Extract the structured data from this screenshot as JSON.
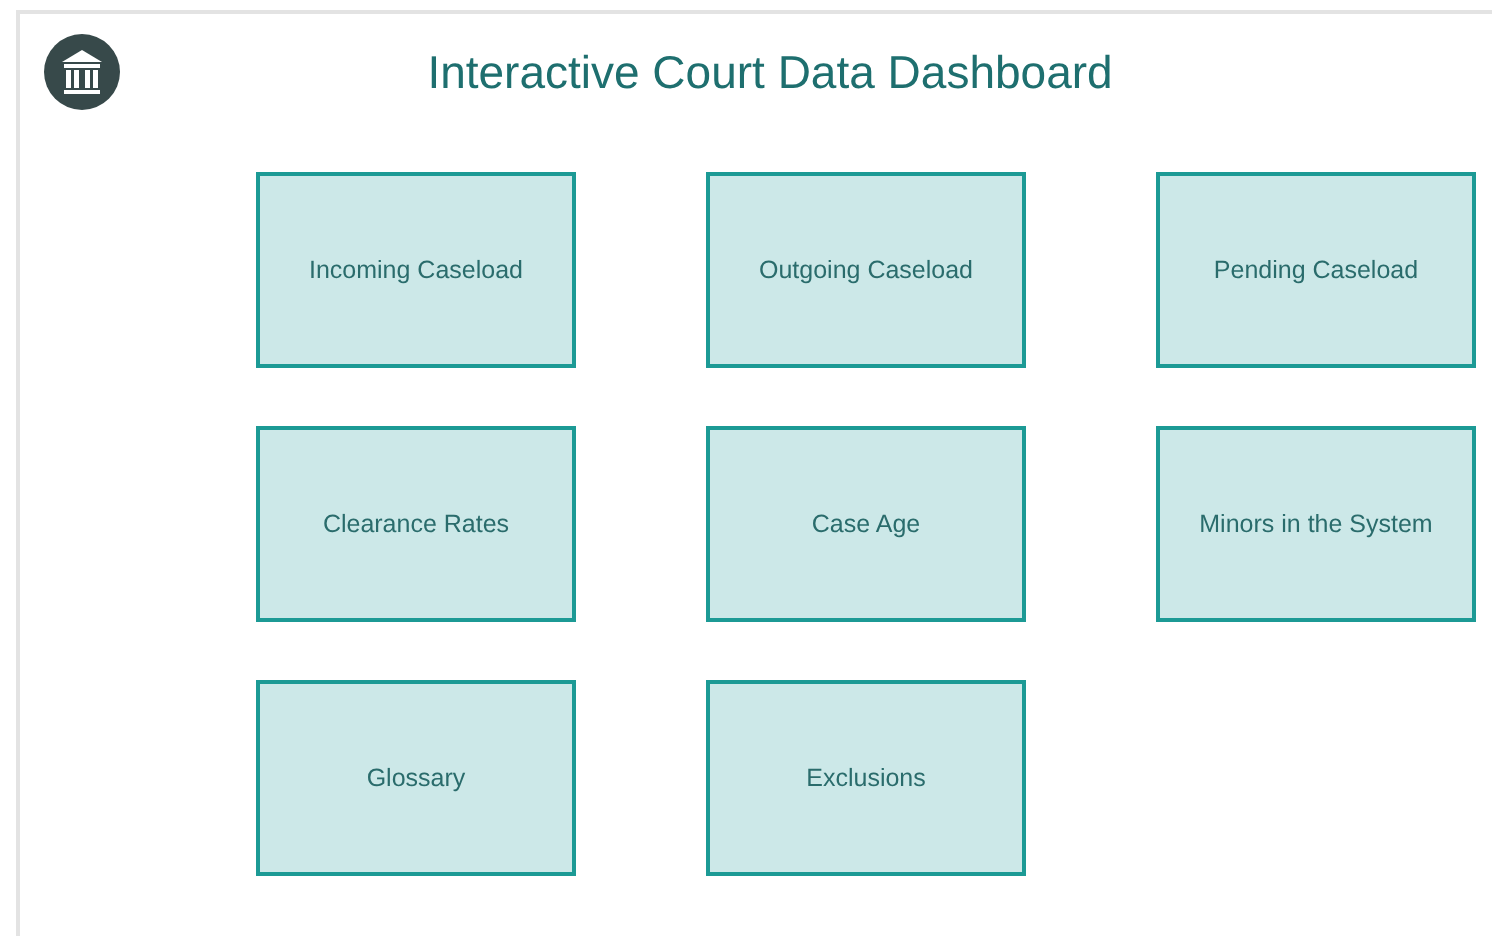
{
  "header": {
    "title": "Interactive Court Data Dashboard"
  },
  "tiles": [
    {
      "label": "Incoming Caseload"
    },
    {
      "label": "Outgoing Caseload"
    },
    {
      "label": "Pending Caseload"
    },
    {
      "label": "Clearance Rates"
    },
    {
      "label": "Case Age"
    },
    {
      "label": "Minors in the System"
    },
    {
      "label": "Glossary"
    },
    {
      "label": "Exclusions"
    }
  ]
}
